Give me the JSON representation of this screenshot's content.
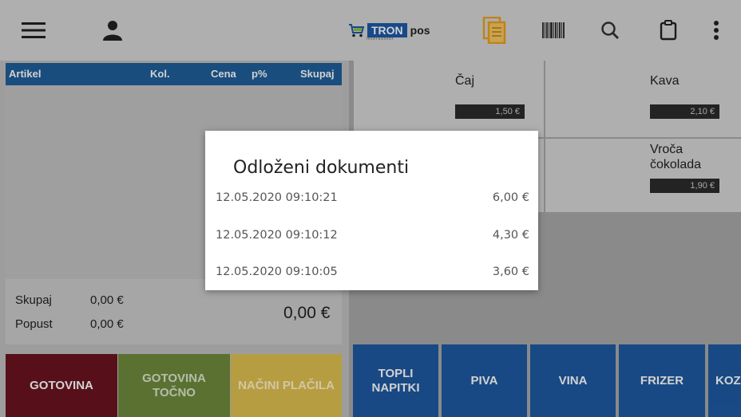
{
  "toolbar": {
    "icons": [
      "menu-icon",
      "user-icon",
      "documents-icon",
      "barcode-icon",
      "search-icon",
      "clipboard-icon",
      "more-vert-icon"
    ],
    "logo": {
      "brand": "TRON",
      "suffix": "pos",
      "subtitle": "interkontor"
    },
    "colors": {
      "background": "#d6d6d6",
      "documents_icon": "#e8a020"
    }
  },
  "order_table": {
    "columns": [
      "Artikel",
      "Kol.",
      "Cena",
      "p%",
      "Skupaj"
    ],
    "header_color": "#1f5e9a",
    "rows": []
  },
  "totals": {
    "skupaj_label": "Skupaj",
    "skupaj_value": "0,00 €",
    "popust_label": "Popust",
    "popust_value": "0,00 €",
    "grand_total": "0,00 €"
  },
  "payment_buttons": [
    {
      "label": "GOTOVINA",
      "color": "#6b1420"
    },
    {
      "label": "GOTOVINA TOČNO",
      "color": "#6e8a3c"
    },
    {
      "label": "NAČINI PLAČILA",
      "color": "#e0c050"
    }
  ],
  "products": [
    {
      "name": "Čaj",
      "price": "1,50 €"
    },
    {
      "name": "Kava",
      "price": "2,10 €"
    },
    {
      "name": "Vroča čokolada",
      "price": "1,90 €"
    }
  ],
  "categories": [
    {
      "label": "TOPLI NAPITKI"
    },
    {
      "label": "PIVA"
    },
    {
      "label": "VINA"
    },
    {
      "label": "FRIZER"
    },
    {
      "label": "KOZ"
    }
  ],
  "dialog": {
    "title": "Odloženi dokumenti",
    "documents": [
      {
        "datetime": "12.05.2020 09:10:21",
        "amount": "6,00 €"
      },
      {
        "datetime": "12.05.2020 09:10:12",
        "amount": "4,30 €"
      },
      {
        "datetime": "12.05.2020 09:10:05",
        "amount": "3,60 €"
      }
    ]
  }
}
